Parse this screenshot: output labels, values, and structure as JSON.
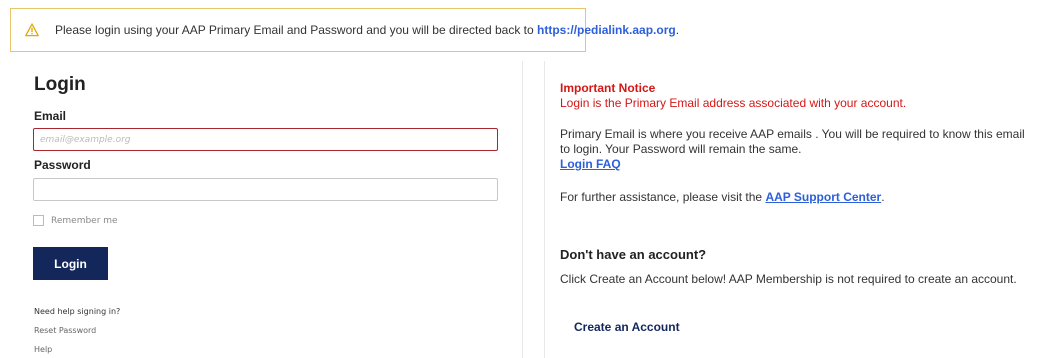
{
  "alert": {
    "message": "Please login using your AAP Primary Email and Password and you will be directed back to ",
    "link_text": "https://pedialink.aap.org",
    "trailing": ".",
    "icon": "warning-icon",
    "color": "#e9c46a"
  },
  "login": {
    "title": "Login",
    "email_label": "Email",
    "email_placeholder": "email@example.org",
    "email_value": "",
    "password_label": "Password",
    "password_value": "",
    "remember_label": "Remember me",
    "button_label": "Login",
    "help_heading": "Need help signing in?",
    "reset_link": "Reset Password",
    "help_link": "Help"
  },
  "notice": {
    "title": "Important Notice",
    "text": "Login is the Primary Email address associated with your account.",
    "primary_email_text": "Primary Email is where you receive AAP emails . You will be required to know this email to login. Your Password will remain the same.",
    "faq_link": "Login FAQ",
    "assistance_text": "For further assistance, please visit the ",
    "support_link": "AAP Support Center",
    "assistance_trailing": "."
  },
  "signup": {
    "heading": "Don't have an account?",
    "text": "Click Create an Account below! AAP Membership is not required to create an account.",
    "create_link": "Create an Account"
  },
  "colors": {
    "primary": "#13275b",
    "link": "#2c5fd9",
    "notice": "#d41717",
    "error_border": "#a9262f"
  }
}
